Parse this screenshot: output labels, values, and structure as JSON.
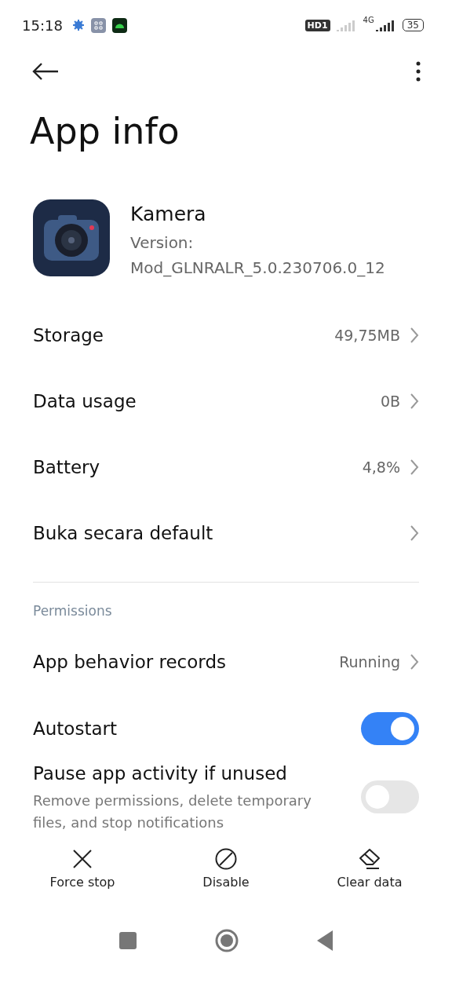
{
  "status_bar": {
    "time": "15:18",
    "hd_badge": "HD1",
    "network": "4G",
    "battery": "35"
  },
  "title": "App info",
  "app": {
    "name": "Kamera",
    "version_label": "Version:",
    "version": "Mod_GLNRALR_5.0.230706.0_12"
  },
  "rows": [
    {
      "kind": "link",
      "label": "Storage",
      "value": "49,75MB"
    },
    {
      "kind": "link",
      "label": "Data usage",
      "value": "0B"
    },
    {
      "kind": "link",
      "label": "Battery",
      "value": "4,8%"
    },
    {
      "kind": "link",
      "label": "Buka secara default"
    }
  ],
  "section": "Permissions",
  "permission_rows": [
    {
      "kind": "link",
      "label": "App behavior records",
      "value": "Running"
    },
    {
      "kind": "toggle",
      "label": "Autostart",
      "on": true
    },
    {
      "kind": "toggle",
      "label": "Pause app activity if unused",
      "subtitle": "Remove permissions, delete temporary files, and stop notifications",
      "on": false
    }
  ],
  "actions": [
    {
      "kind": "stop",
      "label": "Force stop"
    },
    {
      "kind": "disable",
      "label": "Disable"
    },
    {
      "kind": "clear",
      "label": "Clear data"
    }
  ]
}
